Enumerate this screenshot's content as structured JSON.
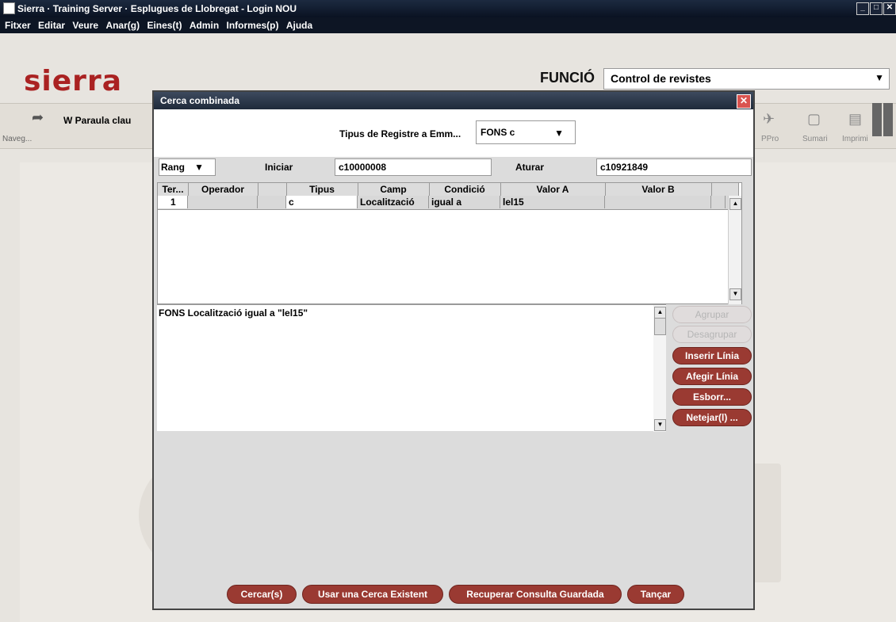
{
  "window": {
    "title": "Sierra · Training Server · Esplugues de Llobregat - Login NOU"
  },
  "menu": [
    {
      "label": "Fitxer"
    },
    {
      "label": "Editar"
    },
    {
      "label": "Veure"
    },
    {
      "label": "Anar(g)"
    },
    {
      "label": "Eines(t)"
    },
    {
      "label": "Admin"
    },
    {
      "label": "Informes(p)"
    },
    {
      "label": "Ajuda"
    }
  ],
  "header": {
    "logo": "sierra",
    "funcio_label": "FUNCIÓ",
    "funcio_value": "Control de revistes"
  },
  "toolbar": {
    "naveg_label": "Naveg...",
    "search_label": "W Paraula clau",
    "right_items": [
      {
        "label": "PPro",
        "icon": "ppro-icon"
      },
      {
        "label": "Sumari",
        "icon": "sumari-icon"
      },
      {
        "label": "Imprimi",
        "icon": "print-icon"
      }
    ]
  },
  "dialog": {
    "title": "Cerca combinada",
    "record_type_label": "Tipus de Registre a Emm...",
    "record_type_value": "FONS c",
    "range_value": "Rang",
    "iniciar_label": "Iniciar",
    "iniciar_value": "c10000008",
    "aturar_label": "Aturar",
    "aturar_value": "c10921849",
    "grid": {
      "columns": [
        "Ter...",
        "Operador",
        "",
        "Tipus",
        "Camp",
        "Condició",
        "Valor A",
        "Valor B",
        ""
      ],
      "rows": [
        {
          "ter": "1",
          "operador": "",
          "tipus": "c",
          "camp": "Localització",
          "condicio": "igual a",
          "valor_a": "lel15",
          "valor_b": ""
        }
      ]
    },
    "query_text": "FONS Localització igual a \"lel15\"",
    "side_buttons": [
      {
        "label": "Agrupar",
        "enabled": false
      },
      {
        "label": "Desagrupar",
        "enabled": false
      },
      {
        "label": "Inserir Línia",
        "enabled": true
      },
      {
        "label": "Afegir Línia",
        "enabled": true
      },
      {
        "label": "Esborr...",
        "enabled": true
      },
      {
        "label": "Netejar(l) ...",
        "enabled": true
      }
    ],
    "bottom_buttons": [
      {
        "label": "Cercar(s)"
      },
      {
        "label": "Usar una Cerca Existent"
      },
      {
        "label": "Recuperar Consulta Guardada"
      },
      {
        "label": "Tançar"
      }
    ]
  },
  "colors": {
    "accent": "#9a3a32",
    "titlebar": "#0d1524",
    "logo": "#aa2222"
  }
}
